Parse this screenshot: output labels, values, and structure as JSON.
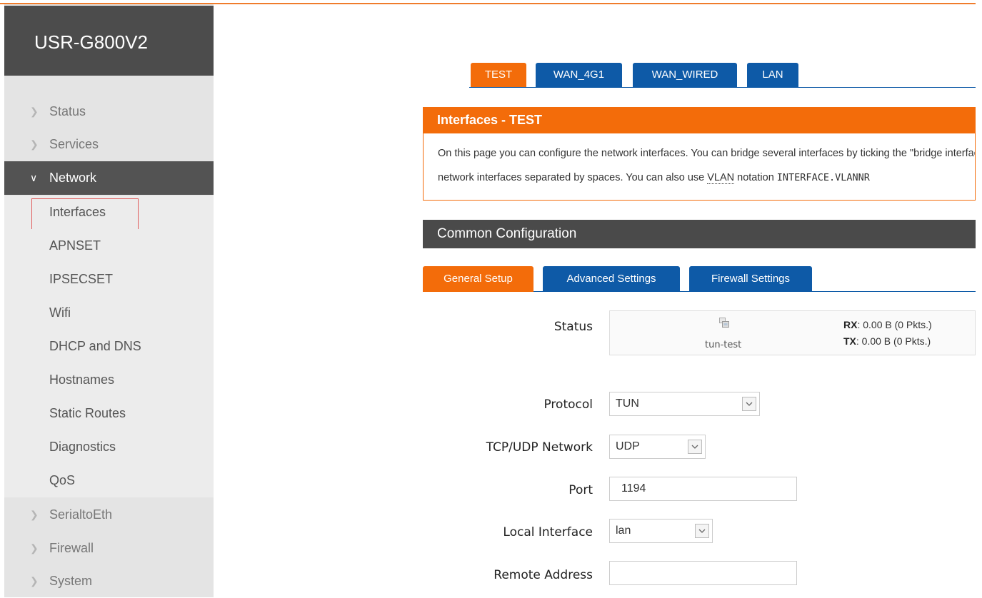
{
  "app": {
    "brand": "USR-G800V2"
  },
  "sidebar": {
    "top_items": [
      {
        "label": "Status"
      },
      {
        "label": "Services"
      },
      {
        "label": "Network"
      }
    ],
    "network_sub": [
      {
        "label": "Interfaces"
      },
      {
        "label": "APNSET"
      },
      {
        "label": "IPSECSET"
      },
      {
        "label": "Wifi"
      },
      {
        "label": "DHCP and DNS"
      },
      {
        "label": "Hostnames"
      },
      {
        "label": "Static Routes"
      },
      {
        "label": "Diagnostics"
      },
      {
        "label": "QoS"
      }
    ],
    "bottom_items": [
      {
        "label": "SerialtoEth"
      },
      {
        "label": "Firewall"
      },
      {
        "label": "System"
      }
    ]
  },
  "interface_tabs": [
    {
      "label": "TEST",
      "active": true
    },
    {
      "label": "WAN_4G1",
      "active": false
    },
    {
      "label": "WAN_WIRED",
      "active": false
    },
    {
      "label": "LAN",
      "active": false
    }
  ],
  "section": {
    "title": "Interfaces - TEST",
    "desc_line1": "On this page you can configure the network interfaces. You can bridge several interfaces by ticking the \"bridge interfaces\" field and enter the names of several",
    "desc_line2_a": "network interfaces separated by spaces. You can also use ",
    "desc_line2_abbr": "VLAN",
    "desc_line2_b": " notation ",
    "desc_line2_code": "INTERFACE.VLANNR"
  },
  "common": {
    "title": "Common Configuration",
    "tabs": [
      {
        "label": "General Setup",
        "active": true
      },
      {
        "label": "Advanced Settings",
        "active": false
      },
      {
        "label": "Firewall Settings",
        "active": false
      }
    ]
  },
  "form": {
    "status_label": "Status",
    "status_ifname": "tun-test",
    "status_rx_label": "RX",
    "status_rx_value": ": 0.00 B (0 Pkts.)",
    "status_tx_label": "TX",
    "status_tx_value": ": 0.00 B (0 Pkts.)",
    "protocol_label": "Protocol",
    "protocol_value": "TUN",
    "network_label": "TCP/UDP Network",
    "network_value": "UDP",
    "port_label": "Port",
    "port_value": "1194",
    "local_iface_label": "Local Interface",
    "local_iface_value": "lan",
    "remote_label": "Remote Address",
    "remote_value": ""
  },
  "colors": {
    "accent": "#f36c0a",
    "tab_blue": "#0e5aa7",
    "sidebar_dark": "#4c4c4c",
    "highlight": "#e05b5b"
  }
}
